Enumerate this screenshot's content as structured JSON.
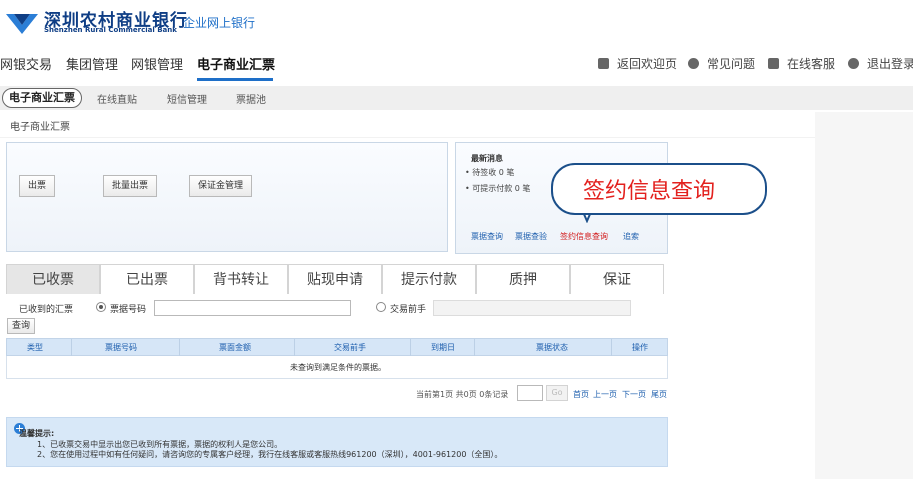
{
  "bank": {
    "name_cn": "深圳农村商业银行",
    "name_en": "Shenzhen Rural Commercial Bank",
    "portal": "企业网上银行"
  },
  "nav": {
    "items": [
      "网银交易",
      "集团管理",
      "网银管理",
      "电子商业汇票"
    ],
    "active": "电子商业汇票",
    "utilities": [
      {
        "label": "返回欢迎页",
        "icon": "home-icon"
      },
      {
        "label": "常见问题",
        "icon": "help-icon"
      },
      {
        "label": "在线客服",
        "icon": "chat-icon"
      },
      {
        "label": "退出登录",
        "icon": "power-icon"
      }
    ]
  },
  "subnav": {
    "active": "电子商业汇票",
    "items": [
      "在线直贴",
      "短信管理",
      "票据池"
    ]
  },
  "breadcrumb": "电子商业汇票",
  "actions": [
    "出票",
    "批量出票",
    "保证金管理"
  ],
  "news": {
    "title": "最新消息",
    "lines": [
      "• 待签收 0 笔",
      "• 可提示付款 0 笔"
    ],
    "links": [
      "票据查询",
      "票据查验",
      "签约信息查询",
      "追索"
    ]
  },
  "callout": "签约信息查询",
  "tabs": [
    "已收票",
    "已出票",
    "背书转让",
    "贴现申请",
    "提示付款",
    "质押",
    "保证"
  ],
  "active_tab": "已收票",
  "filter": {
    "label": "已收到的汇票",
    "opt1": "票据号码",
    "opt2": "交易前手",
    "query": "查询"
  },
  "table": {
    "columns": [
      "类型",
      "票据号码",
      "票面金额",
      "交易前手",
      "到期日",
      "票据状态",
      "操作"
    ],
    "empty": "未查询到满足条件的票据。"
  },
  "pager": {
    "info": "当前第1页 共0页 0条记录",
    "go": "Go",
    "links": [
      "首页",
      "上一页",
      "下一页",
      "尾页"
    ]
  },
  "tips": {
    "title": "温馨提示:",
    "lines": [
      "1、已收票交易中显示出您已收到所有票据，票据的权利人是您公司。",
      "2、您在使用过程中如有任何疑问，请咨询您的专属客户经理，我行在线客服或客服热线961200（深圳），4001-961200（全国）。"
    ]
  },
  "colors": {
    "brand": "#0f3e85",
    "accent": "#1e6fc8",
    "highlight": "#e3211e"
  }
}
